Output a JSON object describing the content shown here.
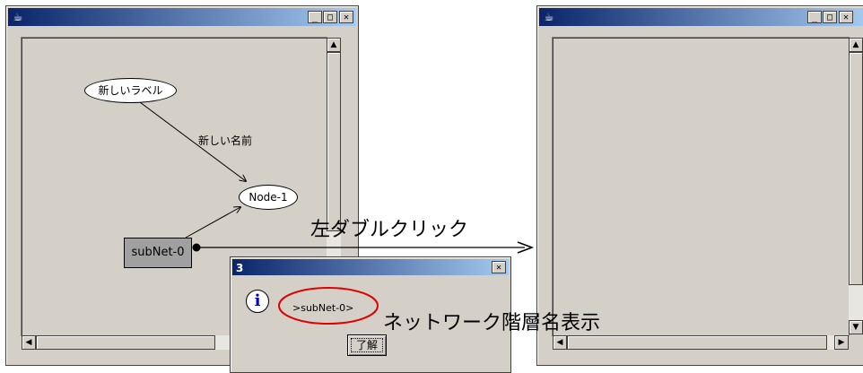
{
  "left_window": {
    "icon": "java-coffee-icon",
    "titlebar_buttons": {
      "minimize": "_",
      "maximize": "□",
      "close": "✕"
    },
    "graph": {
      "label_node": "新しいラベル",
      "edge_label": "新しい名前",
      "node": "Node-1",
      "subnet": "subNet-0"
    }
  },
  "right_window": {
    "icon": "java-coffee-icon",
    "titlebar_buttons": {
      "minimize": "_",
      "maximize": "□",
      "close": "✕"
    }
  },
  "dialog": {
    "title": "3",
    "close": "✕",
    "icon": "info-icon",
    "message": ">subNet-0>",
    "ok_button": "了解"
  },
  "annotations": {
    "action": "左ダブルクリック",
    "result": "ネットワーク階層名表示"
  },
  "colors": {
    "titlebar_start": "#0a246a",
    "titlebar_end": "#a6caf0",
    "window_bg": "#d4d0c8",
    "highlight_ellipse": "#e00000"
  }
}
